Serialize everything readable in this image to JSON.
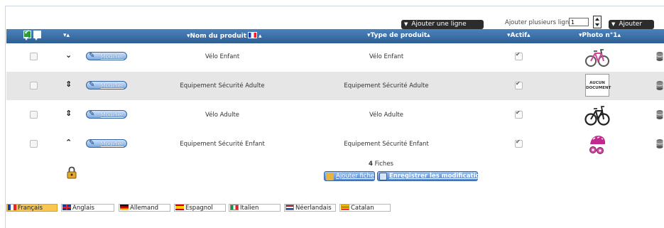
{
  "toolbar": {
    "add_line_label": "Ajouter une ligne",
    "add_several_label": "Ajouter plusieurs lignes :",
    "add_count_value": "1",
    "add_button_label": "Ajouter"
  },
  "table": {
    "headers": {
      "sort": "▾▴",
      "product_name": "▾Nom du produit",
      "product_name_suffix": "▴",
      "product_type": "▾Type de produit▴",
      "active": "▾Actif▴",
      "photo": "▾Photo n°1▴"
    },
    "rows": [
      {
        "product_name": "Vélo Enfant",
        "product_type": "Vélo Enfant",
        "sort_icon": "⌄",
        "photo": "bike-pink-image"
      },
      {
        "product_name": "Equipement Sécurité Adulte",
        "product_type": "Equipement Sécurité Adulte",
        "sort_icon": "⇕",
        "photo": "no-document-placeholder"
      },
      {
        "product_name": "Vélo Adulte",
        "product_type": "Vélo Adulte",
        "sort_icon": "⇕",
        "photo": "bike-black-image"
      },
      {
        "product_name": "Equipement Sécurité Enfant",
        "product_type": "Equipement Sécurité Enfant",
        "sort_icon": "⌃",
        "photo": "helmet-pink-image"
      }
    ],
    "modify_label": "Modifier",
    "no_document_label": "AUCUN DOCUMENT"
  },
  "footer": {
    "count_number": "4",
    "count_label": "Fiches",
    "add_fiche_label": "Ajouter fiche",
    "save_label": "Enregistrer les modifications"
  },
  "languages": [
    {
      "label": "Français",
      "active": true
    },
    {
      "label": "Anglais",
      "active": false
    },
    {
      "label": "Allemand",
      "active": false
    },
    {
      "label": "Espagnol",
      "active": false
    },
    {
      "label": "Italien",
      "active": false
    },
    {
      "label": "Néerlandais",
      "active": false
    },
    {
      "label": "Catalan",
      "active": false
    }
  ],
  "colors": {
    "header_bg": "#3a6ea5",
    "active_tab": "#f9c74f",
    "dark_button": "#2c2c2c"
  }
}
